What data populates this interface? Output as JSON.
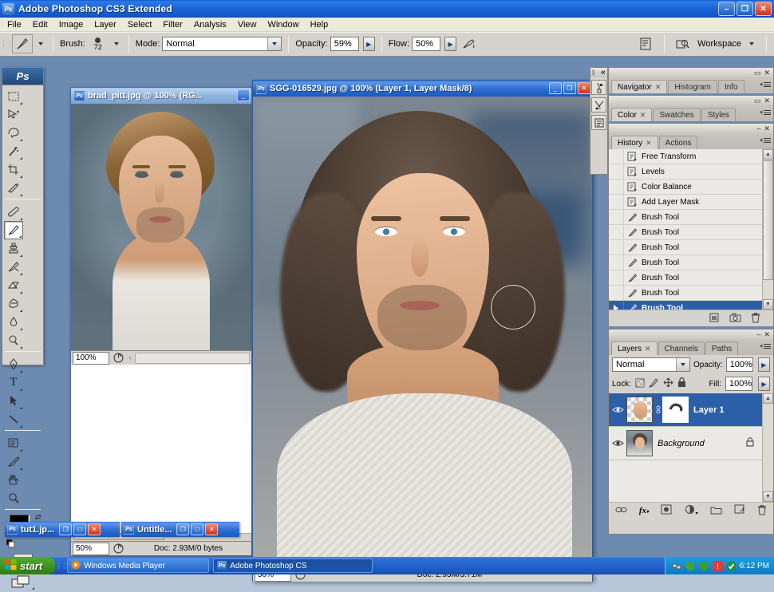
{
  "app": {
    "title": "Adobe Photoshop CS3 Extended",
    "icon": "photoshop-icon",
    "minimize": "–",
    "maximize": "❐",
    "close": "✕"
  },
  "menubar": {
    "items": [
      {
        "label": "File"
      },
      {
        "label": "Edit"
      },
      {
        "label": "Image"
      },
      {
        "label": "Layer"
      },
      {
        "label": "Select"
      },
      {
        "label": "Filter"
      },
      {
        "label": "Analysis"
      },
      {
        "label": "View"
      },
      {
        "label": "Window"
      },
      {
        "label": "Help"
      }
    ]
  },
  "options_bar": {
    "active_tool": "brush-tool",
    "brush_label": "Brush:",
    "brush_size": "72",
    "mode_label": "Mode:",
    "mode_value": "Normal",
    "opacity_label": "Opacity:",
    "opacity_value": "59%",
    "flow_label": "Flow:",
    "flow_value": "50%",
    "airbrush": "airbrush-toggle",
    "palettes_icon": "palettes-icon",
    "bridge_icon": "go-to-bridge-icon",
    "workspace_label": "Workspace"
  },
  "toolbox": {
    "logo": "Ps",
    "tools": [
      {
        "name": "rectangular-marquee-tool",
        "glyph": "⬚"
      },
      {
        "name": "move-tool",
        "glyph": "✥"
      },
      {
        "name": "lasso-tool",
        "glyph": "➿"
      },
      {
        "name": "magic-wand-tool",
        "glyph": "✦"
      },
      {
        "name": "crop-tool",
        "glyph": "⌐"
      },
      {
        "name": "slice-tool",
        "glyph": "✂"
      },
      {
        "name": "healing-brush-tool",
        "glyph": "✎"
      },
      {
        "name": "brush-tool",
        "glyph": "✐"
      },
      {
        "name": "clone-stamp-tool",
        "glyph": "⚑"
      },
      {
        "name": "history-brush-tool",
        "glyph": "✒"
      },
      {
        "name": "eraser-tool",
        "glyph": "▱"
      },
      {
        "name": "gradient-tool",
        "glyph": "◧"
      },
      {
        "name": "blur-tool",
        "glyph": "●"
      },
      {
        "name": "dodge-tool",
        "glyph": "◖"
      },
      {
        "name": "pen-tool",
        "glyph": "✒"
      },
      {
        "name": "type-tool",
        "glyph": "T"
      },
      {
        "name": "path-selection-tool",
        "glyph": "➤"
      },
      {
        "name": "line-tool",
        "glyph": "╲"
      },
      {
        "name": "notes-tool",
        "glyph": "☰"
      },
      {
        "name": "eyedropper-tool",
        "glyph": "⚗"
      },
      {
        "name": "hand-tool",
        "glyph": "✋"
      },
      {
        "name": "zoom-tool",
        "glyph": "⌕"
      }
    ],
    "foreground_color": "#000000",
    "background_color": "#ffffff",
    "quick_mask": "quick-mask-mode",
    "screen_mode": "screen-mode-button"
  },
  "documents": [
    {
      "name": "brad_pitt",
      "title": "brad_pitt.jpg @ 100% (RG...",
      "active": false,
      "zoom": "100%",
      "status": "",
      "bottom_zoom": "50%",
      "bottom_status": "Doc: 2.93M/0 bytes"
    },
    {
      "name": "sgg-016529",
      "title": "SGG-016529.jpg @ 100% (Layer 1, Layer Mask/8)",
      "active": true,
      "zoom": "50%",
      "bottom_status": "Doc: 2.93M/3.71M"
    }
  ],
  "minimized_docs": [
    {
      "title": "tut1.jp..."
    },
    {
      "title": "Untitle..."
    }
  ],
  "dock_rail": {
    "collapse": "«",
    "buttons": [
      {
        "name": "brush-presets-icon"
      },
      {
        "name": "tool-presets-icon"
      },
      {
        "name": "layer-comps-icon"
      }
    ]
  },
  "panels": {
    "navigator_group": {
      "tabs": [
        {
          "label": "Navigator",
          "active": true,
          "closable": true
        },
        {
          "label": "Histogram",
          "active": false,
          "closable": false
        },
        {
          "label": "Info",
          "active": false,
          "closable": false
        }
      ]
    },
    "color_group": {
      "tabs": [
        {
          "label": "Color",
          "active": true,
          "closable": true
        },
        {
          "label": "Swatches",
          "active": false,
          "closable": false
        },
        {
          "label": "Styles",
          "active": false,
          "closable": false
        }
      ]
    },
    "history_group": {
      "tabs": [
        {
          "label": "History",
          "active": true,
          "closable": true
        },
        {
          "label": "Actions",
          "active": false,
          "closable": false
        }
      ],
      "items": [
        {
          "label": "Free Transform",
          "icon": "history-state-icon",
          "selected": false
        },
        {
          "label": "Levels",
          "icon": "history-state-icon",
          "selected": false
        },
        {
          "label": "Color Balance",
          "icon": "history-state-icon",
          "selected": false
        },
        {
          "label": "Add Layer Mask",
          "icon": "history-state-icon",
          "selected": false
        },
        {
          "label": "Brush Tool",
          "icon": "brush-state-icon",
          "selected": false
        },
        {
          "label": "Brush Tool",
          "icon": "brush-state-icon",
          "selected": false
        },
        {
          "label": "Brush Tool",
          "icon": "brush-state-icon",
          "selected": false
        },
        {
          "label": "Brush Tool",
          "icon": "brush-state-icon",
          "selected": false
        },
        {
          "label": "Brush Tool",
          "icon": "brush-state-icon",
          "selected": false
        },
        {
          "label": "Brush Tool",
          "icon": "brush-state-icon",
          "selected": false
        },
        {
          "label": "Brush Tool",
          "icon": "brush-state-icon",
          "selected": true
        }
      ],
      "footer_buttons": [
        {
          "name": "create-document-from-state-icon"
        },
        {
          "name": "create-new-snapshot-icon"
        },
        {
          "name": "delete-state-icon"
        }
      ]
    },
    "layers_group": {
      "tabs": [
        {
          "label": "Layers",
          "active": true,
          "closable": true
        },
        {
          "label": "Channels",
          "active": false,
          "closable": false
        },
        {
          "label": "Paths",
          "active": false,
          "closable": false
        }
      ],
      "blend_mode": "Normal",
      "opacity_label": "Opacity:",
      "opacity_value": "100%",
      "lock_label": "Lock:",
      "lock_icons": [
        {
          "name": "lock-transparent-pixels-icon"
        },
        {
          "name": "lock-image-pixels-icon"
        },
        {
          "name": "lock-position-icon"
        },
        {
          "name": "lock-all-icon"
        }
      ],
      "fill_label": "Fill:",
      "fill_value": "100%",
      "layers": [
        {
          "name": "Layer 1",
          "selected": true,
          "visible": true,
          "has_mask": true,
          "locked": false
        },
        {
          "name": "Background",
          "selected": false,
          "visible": true,
          "has_mask": false,
          "locked": true
        }
      ],
      "footer_buttons": [
        {
          "name": "link-layers-icon",
          "glyph": "⚭"
        },
        {
          "name": "layer-style-icon",
          "glyph": "fx"
        },
        {
          "name": "add-layer-mask-icon",
          "glyph": "▣"
        },
        {
          "name": "new-adjustment-layer-icon",
          "glyph": "◑"
        },
        {
          "name": "new-group-icon",
          "glyph": "▭"
        },
        {
          "name": "new-layer-icon",
          "glyph": "⧉"
        },
        {
          "name": "delete-layer-icon",
          "glyph": "Ὕ1"
        }
      ]
    }
  },
  "taskbar": {
    "start_label": "start",
    "tasks": [
      {
        "label": "Windows Media Player",
        "icon": "media-player-icon",
        "active": false
      },
      {
        "label": "Adobe Photoshop CS",
        "icon": "photoshop-icon",
        "active": true
      }
    ],
    "clock": "6:12 PM",
    "tray_icons": [
      {
        "name": "network-icon"
      },
      {
        "name": "shield-icon"
      },
      {
        "name": "volume-icon"
      },
      {
        "name": "updates-icon"
      },
      {
        "name": "antivirus-icon"
      }
    ]
  },
  "colors": {
    "title_blue": "#1d68dd",
    "panel_gray": "#d6d3ce",
    "selection_blue": "#2d5fa8",
    "desktop_blue": "#6d8ab0"
  }
}
